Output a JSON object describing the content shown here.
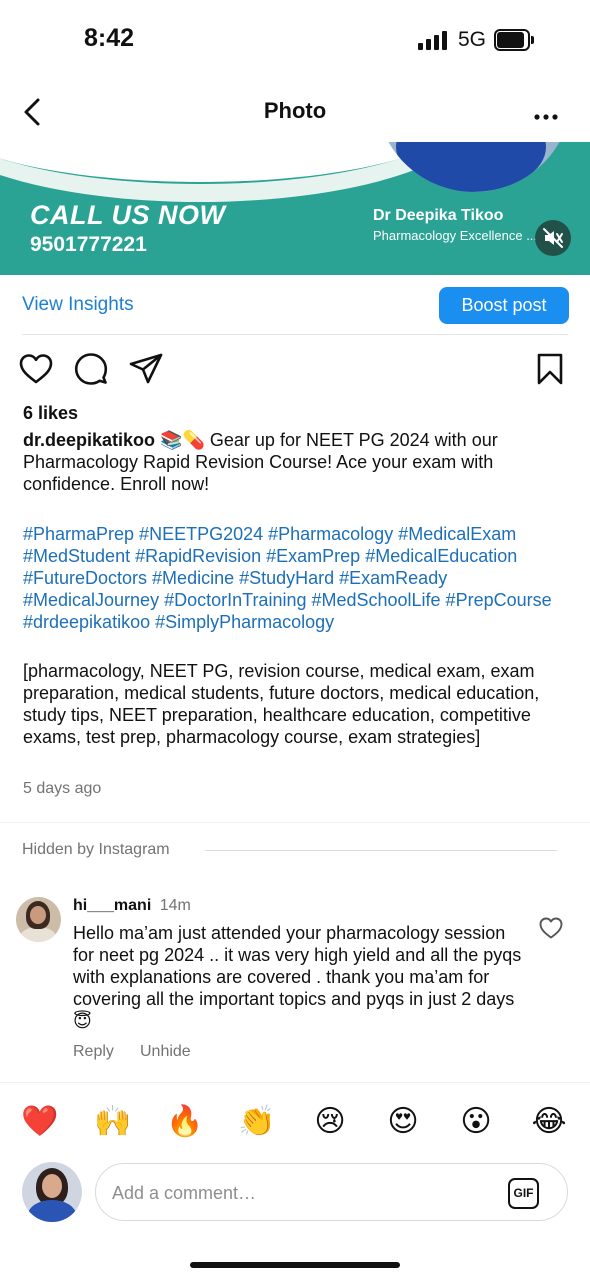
{
  "status": {
    "time": "8:42",
    "network": "5G"
  },
  "header": {
    "title": "Photo"
  },
  "banner": {
    "cta": "CALL US NOW",
    "phone": "9501777221",
    "name": "Dr Deepika Tikoo",
    "tagline": "Pharmacology Excellence ... ch"
  },
  "insights": {
    "view_label": "View Insights",
    "boost_label": "Boost post"
  },
  "post": {
    "likes": "6 likes",
    "username": "dr.deepikatikoo",
    "caption_emoji": "📚💊",
    "caption": "Gear up for NEET PG 2024 with our Pharmacology Rapid Revision Course! Ace your exam with confidence. Enroll now!",
    "hashtags": "#PharmaPrep #NEETPG2024 #Pharmacology #MedicalExam #MedStudent #RapidRevision #ExamPrep #MedicalEducation #FutureDoctors #Medicine #StudyHard #ExamReady #MedicalJourney #DoctorInTraining #MedSchoolLife #PrepCourse #drdeepikatikoo #SimplyPharmacology",
    "keywords": "[pharmacology, NEET PG, revision course, medical exam, exam preparation, medical students, future doctors, medical education, study tips, NEET preparation, healthcare education, competitive exams, test prep, pharmacology course, exam strategies]",
    "posted": "5 days ago"
  },
  "comments": {
    "hidden_label": "Hidden by Instagram",
    "item": {
      "username": "hi___mani",
      "time": "14m",
      "text": "Hello ma’am just attended your pharmacology session for neet pg 2024 .. it was very high yield and all the pyqs with explanations are covered . thank you ma’am for covering all the important topics and pyqs in just 2 days😇",
      "reply_label": "Reply",
      "unhide_label": "Unhide"
    }
  },
  "reactions": [
    "❤️",
    "🙌",
    "🔥",
    "👏",
    "😢",
    "😍",
    "😮",
    "😂"
  ],
  "composer": {
    "placeholder": "Add a comment…",
    "gif_label": "GIF"
  },
  "colors": {
    "accent": "#1a8ff0",
    "link": "#1d6fb8",
    "banner": "#2aa394"
  }
}
